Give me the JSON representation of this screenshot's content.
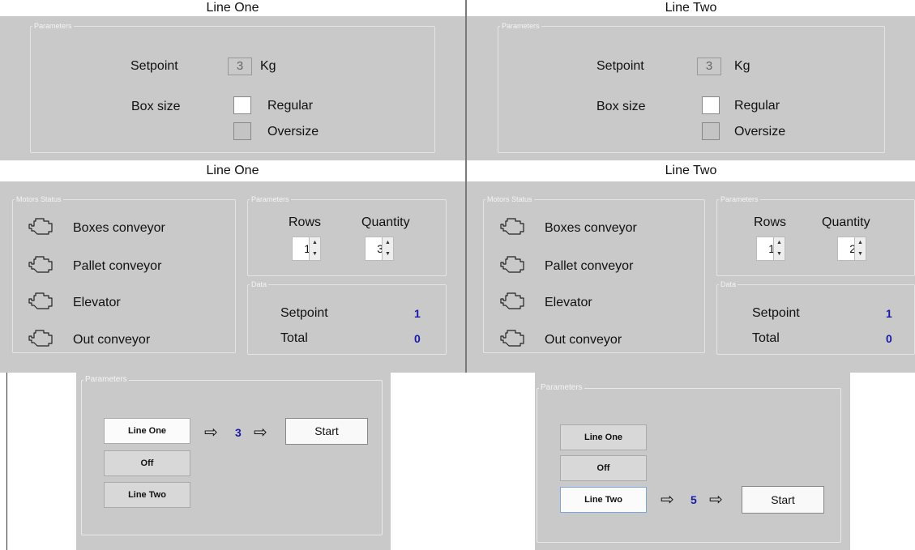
{
  "screens": [
    {
      "title": "Line One",
      "params_legend": "Parameters",
      "setpoint_label": "Setpoint",
      "setpoint_value": "3",
      "setpoint_unit": "Kg",
      "box_size_label": "Box size",
      "regular_label": "Regular",
      "oversize_label": "Oversize",
      "box_size_selected": "Regular"
    },
    {
      "title": "Line Two",
      "params_legend": "Parameters",
      "setpoint_label": "Setpoint",
      "setpoint_value": "3",
      "setpoint_unit": "Kg",
      "box_size_label": "Box size",
      "regular_label": "Regular",
      "oversize_label": "Oversize",
      "box_size_selected": "Regular"
    }
  ],
  "status_screens": [
    {
      "title": "Line One",
      "motors_legend": "Motors Status",
      "motors": [
        "Boxes conveyor",
        "Pallet conveyor",
        "Elevator",
        "Out conveyor"
      ],
      "params_legend": "Parameters",
      "rows_label": "Rows",
      "rows_value": "1",
      "quantity_label": "Quantity",
      "quantity_value": "3",
      "data_legend": "Data",
      "setpoint_label": "Setpoint",
      "setpoint_value": "1",
      "total_label": "Total",
      "total_value": "0"
    },
    {
      "title": "Line Two",
      "motors_legend": "Motors Status",
      "motors": [
        "Boxes conveyor",
        "Pallet conveyor",
        "Elevator",
        "Out conveyor"
      ],
      "params_legend": "Parameters",
      "rows_label": "Rows",
      "rows_value": "1",
      "quantity_label": "Quantity",
      "quantity_value": "2",
      "data_legend": "Data",
      "setpoint_label": "Setpoint",
      "setpoint_value": "1",
      "total_label": "Total",
      "total_value": "0"
    }
  ],
  "selectors": [
    {
      "legend": "Parameters",
      "buttons": [
        "Line One",
        "Off",
        "Line Two"
      ],
      "selected": "Line One",
      "arrow_glyph": "⇨",
      "value": "3",
      "start_label": "Start"
    },
    {
      "legend": "Parameters",
      "buttons": [
        "Line One",
        "Off",
        "Line Two"
      ],
      "selected": "Line Two",
      "arrow_glyph": "⇨",
      "value": "5",
      "start_label": "Start"
    }
  ],
  "colors": {
    "panel": "#c9c9c9",
    "value_blue": "#1a1aa6"
  },
  "icons": {
    "motor": "motor-icon",
    "spin_up": "spin-up-arrow-icon",
    "spin_down": "spin-down-arrow-icon"
  }
}
